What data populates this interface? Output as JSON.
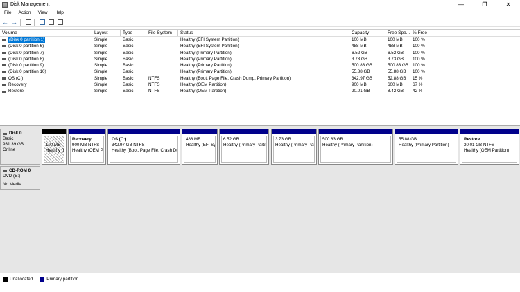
{
  "window": {
    "title": "Disk Management",
    "controls": {
      "minimize": "—",
      "restore": "❐",
      "close": "✕"
    }
  },
  "menu": [
    "File",
    "Action",
    "View",
    "Help"
  ],
  "toolbar": {
    "icons": [
      "back-arrow-icon",
      "forward-arrow-icon",
      "grid-view-icon",
      "help-icon",
      "properties-icon",
      "console-icon"
    ]
  },
  "list": {
    "columns": [
      "Volume",
      "Layout",
      "Type",
      "File System",
      "Status",
      "Capacity",
      "Free Spa...",
      "% Free"
    ],
    "rows": [
      {
        "volume": "(Disk 0 partition 1)",
        "layout": "Simple",
        "type": "Basic",
        "fs": "",
        "status": "Healthy (EFI System Partition)",
        "capacity": "100 MB",
        "free": "100 MB",
        "pct": "100 %"
      },
      {
        "volume": "(Disk 0 partition 6)",
        "layout": "Simple",
        "type": "Basic",
        "fs": "",
        "status": "Healthy (EFI System Partition)",
        "capacity": "488 MB",
        "free": "488 MB",
        "pct": "100 %"
      },
      {
        "volume": "(Disk 0 partition 7)",
        "layout": "Simple",
        "type": "Basic",
        "fs": "",
        "status": "Healthy (Primary Partition)",
        "capacity": "6.52 GB",
        "free": "6.52 GB",
        "pct": "100 %"
      },
      {
        "volume": "(Disk 0 partition 8)",
        "layout": "Simple",
        "type": "Basic",
        "fs": "",
        "status": "Healthy (Primary Partition)",
        "capacity": "3.73 GB",
        "free": "3.73 GB",
        "pct": "100 %"
      },
      {
        "volume": "(Disk 0 partition 9)",
        "layout": "Simple",
        "type": "Basic",
        "fs": "",
        "status": "Healthy (Primary Partition)",
        "capacity": "500.83 GB",
        "free": "500.83 GB",
        "pct": "100 %"
      },
      {
        "volume": "(Disk 0 partition 10)",
        "layout": "Simple",
        "type": "Basic",
        "fs": "",
        "status": "Healthy (Primary Partition)",
        "capacity": "55.88 GB",
        "free": "55.88 GB",
        "pct": "100 %"
      },
      {
        "volume": "OS (C:)",
        "layout": "Simple",
        "type": "Basic",
        "fs": "NTFS",
        "status": "Healthy (Boot, Page File, Crash Dump, Primary Partition)",
        "capacity": "342.97 GB",
        "free": "52.88 GB",
        "pct": "15 %"
      },
      {
        "volume": "Recovery",
        "layout": "Simple",
        "type": "Basic",
        "fs": "NTFS",
        "status": "Healthy (OEM Partition)",
        "capacity": "900 MB",
        "free": "600 MB",
        "pct": "67 %"
      },
      {
        "volume": "Restore",
        "layout": "Simple",
        "type": "Basic",
        "fs": "NTFS",
        "status": "Healthy (OEM Partition)",
        "capacity": "20.01 GB",
        "free": "8.42 GB",
        "pct": "42 %"
      }
    ]
  },
  "disks": {
    "disk0": {
      "name": "Disk 0",
      "type": "Basic",
      "size": "931.39 GB",
      "state": "Online",
      "partitions": [
        {
          "name": "",
          "size": "100 MB",
          "status": "Healthy (E"
        },
        {
          "name": "Recovery",
          "size": "900 MB NTFS",
          "status": "Healthy (OEM Pa"
        },
        {
          "name": "OS  (C:)",
          "size": "342.97 GB NTFS",
          "status": "Healthy (Boot, Page File, Crash Du"
        },
        {
          "name": "",
          "size": "488 MB",
          "status": "Healthy (EFI Sy"
        },
        {
          "name": "",
          "size": "6.52 GB",
          "status": "Healthy (Primary Partit"
        },
        {
          "name": "",
          "size": "3.73 GB",
          "status": "Healthy (Primary Partit"
        },
        {
          "name": "",
          "size": "500.83 GB",
          "status": "Healthy (Primary Partition)"
        },
        {
          "name": "",
          "size": "55.88 GB",
          "status": "Healthy (Primary Partition)"
        },
        {
          "name": "Restore",
          "size": "20.01 GB NTFS",
          "status": "Healthy (OEM Partition)"
        }
      ]
    },
    "cdrom0": {
      "name": "CD-ROM 0",
      "type": "DVD (E:)",
      "state": "No Media"
    }
  },
  "legend": {
    "unallocated": "Unallocated",
    "primary": "Primary partition"
  },
  "colors": {
    "primary": "#00008b",
    "unallocated": "#000000",
    "selection": "#0078d7"
  }
}
